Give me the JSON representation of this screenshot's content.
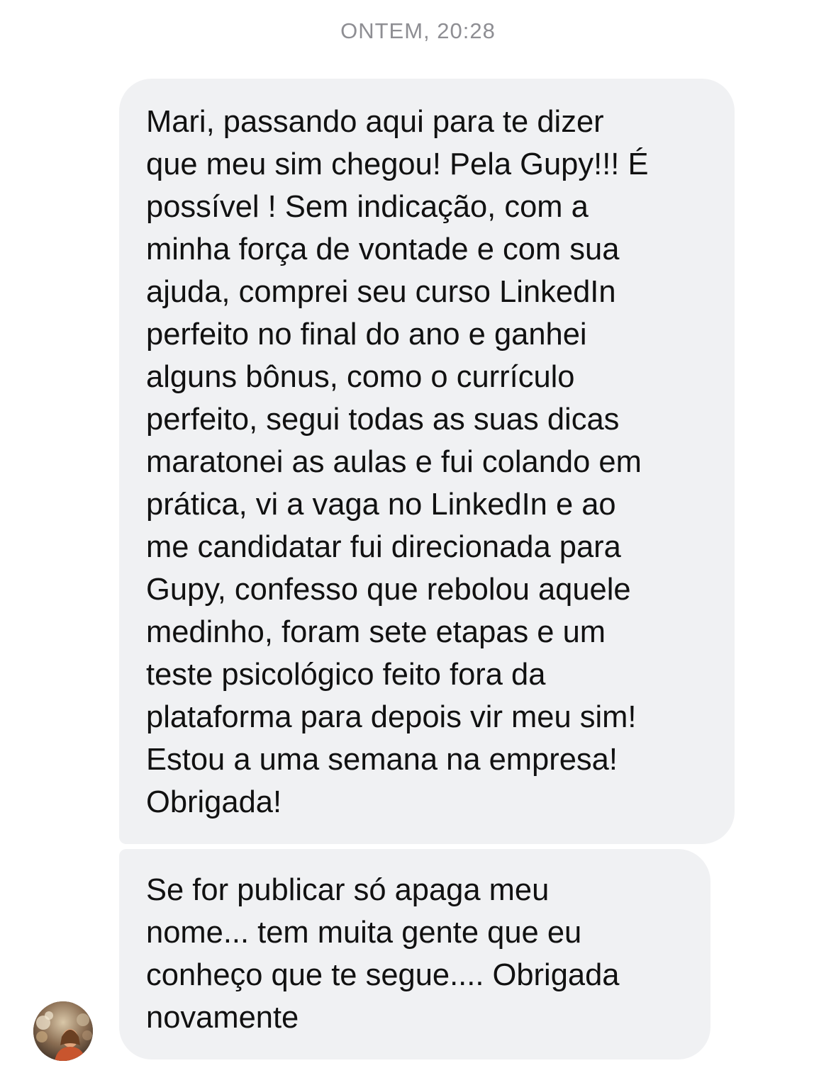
{
  "chat": {
    "timestamp": "ONTEM, 20:28",
    "messages": [
      {
        "lines": [
          "Mari, passando aqui para te dizer",
          "que meu sim chegou! Pela Gupy!!! É",
          "possível ! Sem indicação, com a",
          "minha força de vontade e com sua",
          "ajuda, comprei seu curso LinkedIn",
          "perfeito no final do ano e ganhei",
          "alguns bônus, como o currículo",
          "perfeito, segui todas as suas dicas",
          "maratonei as aulas e fui colando em",
          "prática, vi a vaga no LinkedIn e ao",
          "me candidatar fui direcionada para",
          "Gupy, confesso que rebolou aquele",
          "medinho, foram sete etapas e um",
          "teste psicológico feito fora da",
          "plataforma para depois vir meu sim!",
          "Estou a uma semana na empresa!",
          "Obrigada!"
        ]
      },
      {
        "lines": [
          "Se for publicar só apaga meu",
          "nome... tem muita gente que eu",
          "conheço que te segue.... Obrigada",
          "novamente"
        ]
      }
    ],
    "sender_avatar": "profile-photo"
  }
}
